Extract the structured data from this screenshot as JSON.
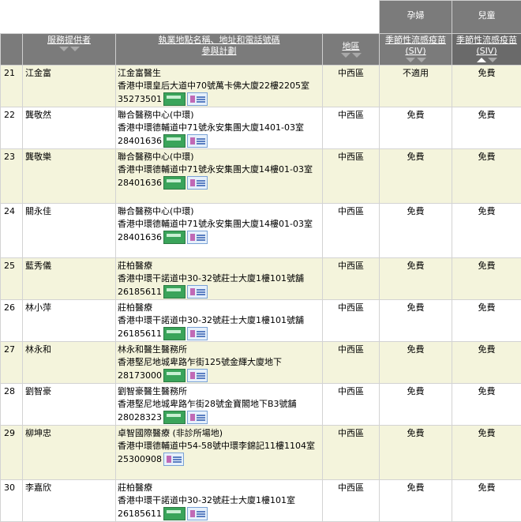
{
  "group_headers": {
    "pregnant": "孕婦",
    "children": "兒童"
  },
  "columns": {
    "provider": "服務提供者",
    "location_line1": "執業地點名稱、地址和電話號碼",
    "location_line2": "參與計劃",
    "district": "地區",
    "siv_line1": "季節性流感疫苗",
    "siv_line2": "(SIV)",
    "siv2_line1": "季節性流感疫苗",
    "siv2_line2": "(SIV)"
  },
  "icons": {
    "logo_green": "vaccination-scheme-logo",
    "logo_blue": "subsidy-scheme-logo"
  },
  "rows": [
    {
      "no": "21",
      "name": "江金富",
      "clinic": "江金富醫生",
      "address": "香港中環皇后大道中70號萬卡佛大廈22樓2205室",
      "phone": "35273501",
      "district": "中西區",
      "preg": "不適用",
      "child": "免費",
      "logos": 2
    },
    {
      "no": "22",
      "name": "龔敬然",
      "clinic": "聯合醫務中心(中環)",
      "address": "香港中環德輔道中71號永安集團大廈1401-03室",
      "phone": "28401636",
      "district": "中西區",
      "preg": "免費",
      "child": "免費",
      "logos": 2
    },
    {
      "no": "23",
      "name": "龔敬樂",
      "clinic": "聯合醫務中心(中環)",
      "address": "香港中環德輔道中71號永安集團大廈14樓01-03室",
      "phone": "28401636",
      "district": "中西區",
      "preg": "免費",
      "child": "免費",
      "logos": 2
    },
    {
      "no": "24",
      "name": "關永佳",
      "clinic": "聯合醫務中心(中環)",
      "address": "香港中環德輔道中71號永安集團大廈14樓01-03室",
      "phone": "28401636",
      "district": "中西區",
      "preg": "免費",
      "child": "免費",
      "logos": 2
    },
    {
      "no": "25",
      "name": "藍秀儀",
      "clinic": "莊柏醫療",
      "address": "香港中環干諾道中30-32號莊士大廈1樓101號舖",
      "phone": "26185611",
      "district": "中西區",
      "preg": "免費",
      "child": "免費",
      "logos": 2
    },
    {
      "no": "26",
      "name": "林小萍",
      "clinic": "莊柏醫療",
      "address": "香港中環干諾道中30-32號莊士大廈1樓101號舖",
      "phone": "26185611",
      "district": "中西區",
      "preg": "免費",
      "child": "免費",
      "logos": 2
    },
    {
      "no": "27",
      "name": "林永和",
      "clinic": "林永和醫生醫務所",
      "address": "香港堅尼地城卑路乍街125號金輝大廈地下",
      "phone": "28173000",
      "district": "中西區",
      "preg": "免費",
      "child": "免費",
      "logos": 2
    },
    {
      "no": "28",
      "name": "劉智豪",
      "clinic": "劉智豪醫生醫務所",
      "address": "香港堅尼地城卑路乍街28號金寶閣地下B3號舖",
      "phone": "28028323",
      "district": "中西區",
      "preg": "免費",
      "child": "免費",
      "logos": 2
    },
    {
      "no": "29",
      "name": "柳坤忠",
      "clinic": "卓智國際醫療 (非診所場地)",
      "address": "香港中環德輔道中54-58號中環李錦記11樓1104室",
      "phone": "25300908",
      "district": "中西區",
      "preg": "免費",
      "child": "免費",
      "logos": 1
    },
    {
      "no": "30",
      "name": "李嘉欣",
      "clinic": "莊柏醫療",
      "address": "香港中環干諾道中30-32號莊士大廈1樓101室",
      "phone": "26185611",
      "district": "中西區",
      "preg": "免費",
      "child": "免費",
      "logos": 2
    }
  ]
}
